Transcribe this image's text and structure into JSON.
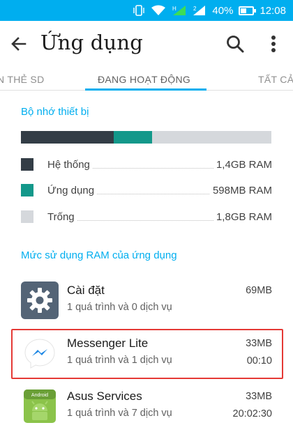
{
  "status_bar": {
    "battery": "40%",
    "time": "12:08",
    "icons": [
      "vibrate-icon",
      "wifi-icon",
      "signal-icon",
      "signal-2-icon",
      "battery-icon"
    ]
  },
  "app_bar": {
    "title": "Ứng dụng",
    "back_icon": "arrow-left-icon",
    "search_icon": "search-icon",
    "more_icon": "more-vert-icon"
  },
  "tabs": [
    {
      "label": "N THẺ SD",
      "active": false
    },
    {
      "label": "ĐANG HOẠT ĐỘNG",
      "active": true
    },
    {
      "label": "TẤT CẢ",
      "active": false
    }
  ],
  "memory": {
    "title": "Bộ nhớ thiết bị",
    "bar_fraction": {
      "system": 0.37,
      "apps": 0.155,
      "free": 0.475
    },
    "legend": [
      {
        "label": "Hệ thống",
        "value": "1,4GB RAM",
        "color": "#333d46"
      },
      {
        "label": "Ứng dụng",
        "value": "598MB RAM",
        "color": "#13988a"
      },
      {
        "label": "Trống",
        "value": "1,8GB RAM",
        "color": "#d5d8dc"
      }
    ]
  },
  "usage": {
    "title": "Mức sử dụng RAM của ứng dụng",
    "apps": [
      {
        "name": "Cài đặt",
        "sub": "1 quá trình và 0 dịch vụ",
        "size": "69MB",
        "time": "",
        "icon": "settings-gear-icon"
      },
      {
        "name": "Messenger Lite",
        "sub": "1 quá trình và 1 dịch vụ",
        "size": "33MB",
        "time": "00:10",
        "icon": "messenger-icon",
        "highlighted": true
      },
      {
        "name": "Asus Services",
        "sub": "1 quá trình và 7 dịch vụ",
        "size": "33MB",
        "time": "20:02:30",
        "icon": "android-icon"
      }
    ]
  },
  "colors": {
    "accent": "#00aeef",
    "highlight_border": "#e53935"
  }
}
